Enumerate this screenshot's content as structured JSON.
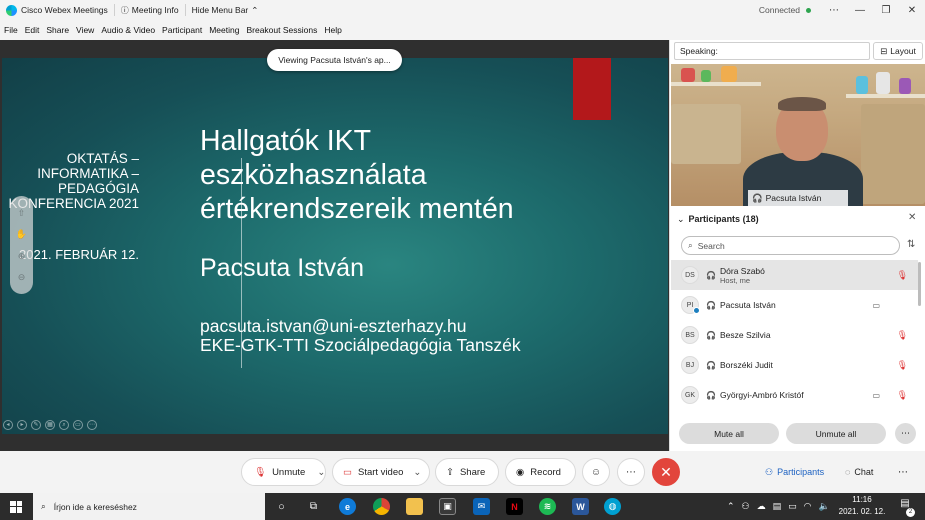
{
  "window": {
    "app_title": "Cisco Webex Meetings",
    "meeting_info": "Meeting Info",
    "hide_menu": "Hide Menu Bar",
    "status": "Connected",
    "status_color": "#2ea44f"
  },
  "menu": [
    "File",
    "Edit",
    "Share",
    "View",
    "Audio & Video",
    "Participant",
    "Meeting",
    "Breakout Sessions",
    "Help"
  ],
  "share_banner": "Viewing Pacsuta István's ap...",
  "slide": {
    "left_lines": [
      "OKTATÁS –",
      "INFORMATIKA –",
      "PEDAGÓGIA",
      "KONFERENCIA 2021"
    ],
    "date": "2021. FEBRUÁR 12.",
    "title_lines": [
      "Hallgatók IKT",
      "eszközhasználata",
      "értékrendszereik mentén"
    ],
    "author": "Pacsuta István",
    "email": "pacsuta.istvan@uni-eszterhazy.hu",
    "department": "EKE-GTK-TTI Szociálpedagógia Tanszék",
    "accent_color": "#b3181b"
  },
  "speaking": {
    "label": "Speaking:",
    "layout": "Layout"
  },
  "video": {
    "name": "Pacsuta István"
  },
  "participants": {
    "header": "Participants (18)",
    "search_placeholder": "Search",
    "list": [
      {
        "initials": "DS",
        "name": "Dóra Szabó",
        "sub": "Host, me",
        "muted": true,
        "camera": false,
        "active": true
      },
      {
        "initials": "PI",
        "name": "Pacsuta István",
        "sub": "",
        "muted": false,
        "camera": true,
        "active": false
      },
      {
        "initials": "BS",
        "name": "Besze Szilvia",
        "sub": "",
        "muted": true,
        "camera": false,
        "active": false
      },
      {
        "initials": "BJ",
        "name": "Borszéki Judit",
        "sub": "",
        "muted": true,
        "camera": false,
        "active": false
      },
      {
        "initials": "GK",
        "name": "Györgyi-Ambró Kristóf",
        "sub": "",
        "muted": true,
        "camera": true,
        "active": false
      }
    ],
    "mute_all": "Mute all",
    "unmute_all": "Unmute all"
  },
  "controls": {
    "unmute": "Unmute",
    "start_video": "Start video",
    "share": "Share",
    "record": "Record",
    "participants": "Participants",
    "chat": "Chat",
    "end_color": "#e2453c"
  },
  "taskbar": {
    "search_placeholder": "Írjon ide a kereséshez",
    "time": "11:16",
    "date": "2021. 02. 12.",
    "notifications": "2"
  }
}
